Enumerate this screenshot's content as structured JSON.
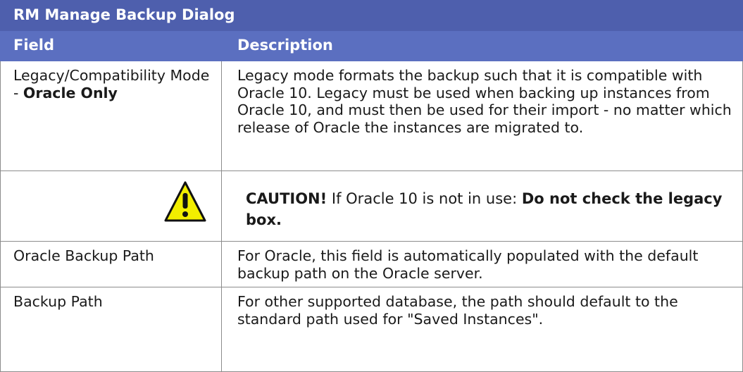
{
  "table": {
    "title": "RM Manage Backup Dialog",
    "headers": {
      "field": "Field",
      "description": "Description"
    },
    "rows": [
      {
        "field_prefix": "Legacy/Compatibility Mode - ",
        "field_bold": "Oracle Only",
        "description": "Legacy mode formats the backup such that it is compatible with Oracle 10. Legacy must be used when backing up instances from Oracle 10, and must then be used for their import - no matter which release of Oracle the instances are migrated to."
      },
      {
        "icon": "warning-triangle-icon",
        "caution_label": "CAUTION!",
        "caution_text": " If Oracle 10 is not in use: ",
        "caution_bold": "Do not check the legacy box."
      },
      {
        "field": "Oracle Backup Path",
        "description": "For Oracle, this field is automatically populated with the default backup path on the Oracle server."
      },
      {
        "field": "Backup Path",
        "description": "For other supported database, the path should default to the standard path used for \"Saved Instances\"."
      }
    ]
  },
  "colors": {
    "title_bg": "#4e5fad",
    "header_bg": "#5b6fc0",
    "warning_fill": "#f2ee00"
  }
}
